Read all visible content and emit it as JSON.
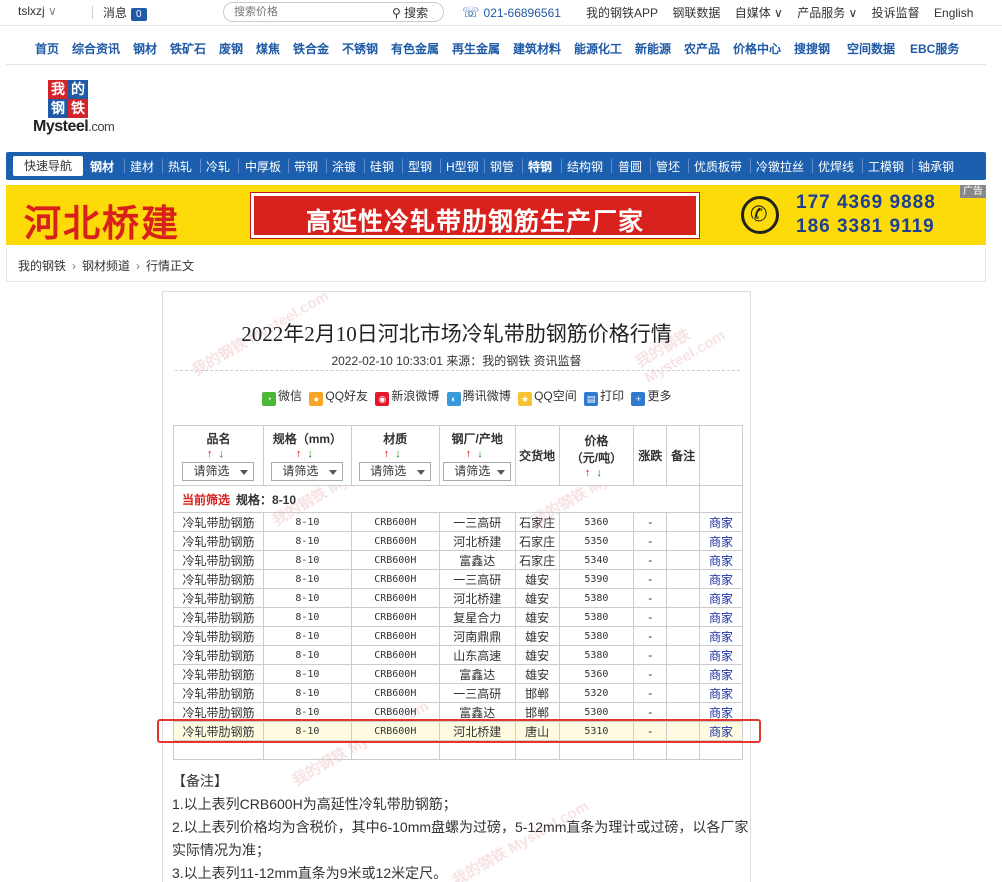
{
  "topbar": {
    "user": "tslxzj",
    "user_caret": "∨",
    "msg_label": "消息",
    "msg_count": "0",
    "search_placeholder": "搜索价格",
    "search_btn": "搜索",
    "phone": "021-66896561",
    "links": [
      "我的钢铁APP",
      "钢联数据",
      "自媒体 ∨",
      "产品服务 ∨",
      "投诉监督",
      "English"
    ]
  },
  "mainnav": [
    "首页",
    "综合资讯",
    "钢材",
    "铁矿石",
    "废钢",
    "煤焦",
    "铁合金",
    "不锈钢",
    "有色金属",
    "再生金属",
    "建筑材料",
    "能源化工",
    "新能源",
    "农产品",
    "价格中心",
    "搜搜钢",
    "空间数据",
    "EBC服务"
  ],
  "logo": {
    "c1": "我",
    "c2": "的",
    "c3": "钢",
    "c4": "铁",
    "brand": "Mysteel",
    "suffix": ".com"
  },
  "catnav": {
    "quick": "快速导航",
    "items": [
      "钢材",
      "建材",
      "热轧",
      "冷轧",
      "中厚板",
      "带钢",
      "涂镀",
      "硅钢",
      "型钢",
      "H型钢",
      "钢管",
      "特钢",
      "结构钢",
      "普圆",
      "管坯",
      "优质板带",
      "冷镦拉丝",
      "优焊线",
      "工模钢",
      "轴承钢"
    ]
  },
  "banner": {
    "left": "河北桥建",
    "slogan": "高延性冷轧带肋钢筋生产厂家",
    "phone1": "177 4369 9888",
    "phone2": "186 3381 9119",
    "ad": "广告"
  },
  "breadcrumb": [
    "我的钢铁",
    "钢材频道",
    "行情正文"
  ],
  "article": {
    "title": "2022年2月10日河北市场冷轧带肋钢筋价格行情",
    "meta": "2022-02-10 10:33:01 来源：我的钢铁 资讯监督",
    "share": [
      "微信",
      "QQ好友",
      "新浪微博",
      "腾讯微博",
      "QQ空间",
      "打印",
      "更多"
    ]
  },
  "table": {
    "headers": {
      "name": "品名",
      "spec": "规格（mm）",
      "material": "材质",
      "factory": "钢厂/产地",
      "place": "交货地",
      "price_1": "价格",
      "price_2": "（元/吨）",
      "change": "涨跌",
      "note": "备注"
    },
    "arrow_up": "↑",
    "arrow_down": "↓",
    "select_label": "请筛选",
    "filter_label": "当前筛选",
    "filter_value": "规格：8-10",
    "rows": [
      {
        "name": "冷轧带肋钢筋",
        "spec": "8-10",
        "material": "CRB600H",
        "factory": "一三高研",
        "place": "石家庄",
        "price": "5360",
        "change": "-",
        "note": "",
        "link": "商家"
      },
      {
        "name": "冷轧带肋钢筋",
        "spec": "8-10",
        "material": "CRB600H",
        "factory": "河北桥建",
        "place": "石家庄",
        "price": "5350",
        "change": "-",
        "note": "",
        "link": "商家"
      },
      {
        "name": "冷轧带肋钢筋",
        "spec": "8-10",
        "material": "CRB600H",
        "factory": "富鑫达",
        "place": "石家庄",
        "price": "5340",
        "change": "-",
        "note": "",
        "link": "商家"
      },
      {
        "name": "冷轧带肋钢筋",
        "spec": "8-10",
        "material": "CRB600H",
        "factory": "一三高研",
        "place": "雄安",
        "price": "5390",
        "change": "-",
        "note": "",
        "link": "商家"
      },
      {
        "name": "冷轧带肋钢筋",
        "spec": "8-10",
        "material": "CRB600H",
        "factory": "河北桥建",
        "place": "雄安",
        "price": "5380",
        "change": "-",
        "note": "",
        "link": "商家"
      },
      {
        "name": "冷轧带肋钢筋",
        "spec": "8-10",
        "material": "CRB600H",
        "factory": "复星合力",
        "place": "雄安",
        "price": "5380",
        "change": "-",
        "note": "",
        "link": "商家"
      },
      {
        "name": "冷轧带肋钢筋",
        "spec": "8-10",
        "material": "CRB600H",
        "factory": "河南鼎鼎",
        "place": "雄安",
        "price": "5380",
        "change": "-",
        "note": "",
        "link": "商家"
      },
      {
        "name": "冷轧带肋钢筋",
        "spec": "8-10",
        "material": "CRB600H",
        "factory": "山东高速",
        "place": "雄安",
        "price": "5380",
        "change": "-",
        "note": "",
        "link": "商家"
      },
      {
        "name": "冷轧带肋钢筋",
        "spec": "8-10",
        "material": "CRB600H",
        "factory": "富鑫达",
        "place": "雄安",
        "price": "5360",
        "change": "-",
        "note": "",
        "link": "商家"
      },
      {
        "name": "冷轧带肋钢筋",
        "spec": "8-10",
        "material": "CRB600H",
        "factory": "一三高研",
        "place": "邯郸",
        "price": "5320",
        "change": "-",
        "note": "",
        "link": "商家"
      },
      {
        "name": "冷轧带肋钢筋",
        "spec": "8-10",
        "material": "CRB600H",
        "factory": "富鑫达",
        "place": "邯郸",
        "price": "5300",
        "change": "-",
        "note": "",
        "link": "商家"
      },
      {
        "name": "冷轧带肋钢筋",
        "spec": "8-10",
        "material": "CRB600H",
        "factory": "河北桥建",
        "place": "唐山",
        "price": "5310",
        "change": "-",
        "note": "",
        "link": "商家"
      }
    ]
  },
  "notes": {
    "heading": "【备注】",
    "lines": [
      "1.以上表列CRB600H为高延性冷轧带肋钢筋；",
      "2.以上表列价格均为含税价，其中6-10mm盘螺为过磅，5-12mm直条为理计或过磅，以各厂家实际情况为准；",
      "3.以上表列11-12mm直条为9米或12米定尺。"
    ]
  },
  "watermark": "我的钢铁 Mysteel.com"
}
